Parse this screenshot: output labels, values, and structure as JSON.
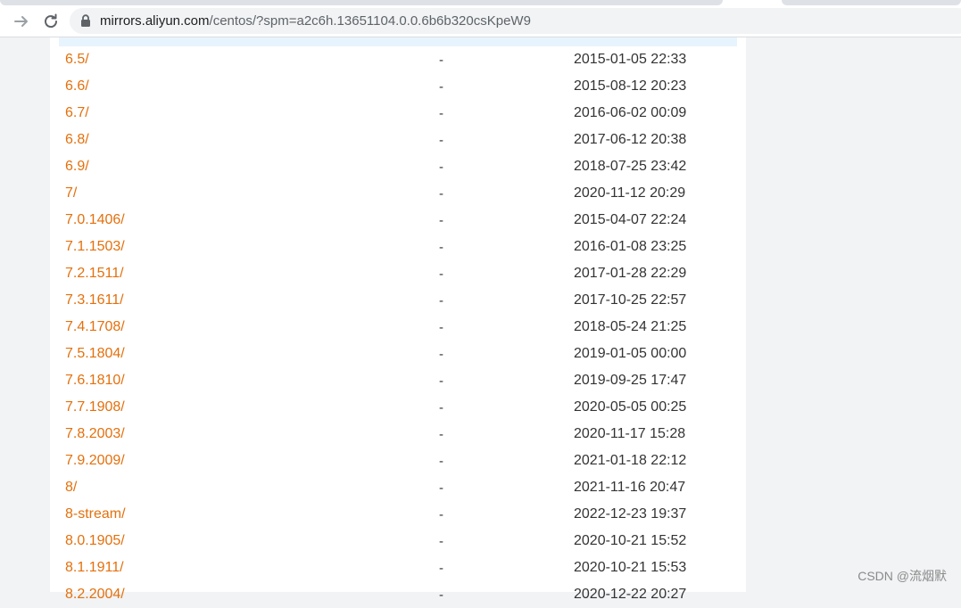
{
  "browser": {
    "url_host": "mirrors.aliyun.com",
    "url_path": "/centos/?spm=a2c6h.13651104.0.0.6b6b320csKpeW9",
    "back_icon": "arrow-right-icon",
    "reload_icon": "reload-icon",
    "lock_icon": "lock-icon"
  },
  "listing": {
    "rows": [
      {
        "name": "6.5/",
        "size": "-",
        "date": "2015-01-05 22:33"
      },
      {
        "name": "6.6/",
        "size": "-",
        "date": "2015-08-12 20:23"
      },
      {
        "name": "6.7/",
        "size": "-",
        "date": "2016-06-02 00:09"
      },
      {
        "name": "6.8/",
        "size": "-",
        "date": "2017-06-12 20:38"
      },
      {
        "name": "6.9/",
        "size": "-",
        "date": "2018-07-25 23:42"
      },
      {
        "name": "7/",
        "size": "-",
        "date": "2020-11-12 20:29"
      },
      {
        "name": "7.0.1406/",
        "size": "-",
        "date": "2015-04-07 22:24"
      },
      {
        "name": "7.1.1503/",
        "size": "-",
        "date": "2016-01-08 23:25"
      },
      {
        "name": "7.2.1511/",
        "size": "-",
        "date": "2017-01-28 22:29"
      },
      {
        "name": "7.3.1611/",
        "size": "-",
        "date": "2017-10-25 22:57"
      },
      {
        "name": "7.4.1708/",
        "size": "-",
        "date": "2018-05-24 21:25"
      },
      {
        "name": "7.5.1804/",
        "size": "-",
        "date": "2019-01-05 00:00"
      },
      {
        "name": "7.6.1810/",
        "size": "-",
        "date": "2019-09-25 17:47"
      },
      {
        "name": "7.7.1908/",
        "size": "-",
        "date": "2020-05-05 00:25"
      },
      {
        "name": "7.8.2003/",
        "size": "-",
        "date": "2020-11-17 15:28"
      },
      {
        "name": "7.9.2009/",
        "size": "-",
        "date": "2021-01-18 22:12"
      },
      {
        "name": "8/",
        "size": "-",
        "date": "2021-11-16 20:47"
      },
      {
        "name": "8-stream/",
        "size": "-",
        "date": "2022-12-23 19:37"
      },
      {
        "name": "8.0.1905/",
        "size": "-",
        "date": "2020-10-21 15:52"
      },
      {
        "name": "8.1.1911/",
        "size": "-",
        "date": "2020-10-21 15:53"
      },
      {
        "name": "8.2.2004/",
        "size": "-",
        "date": "2020-12-22 20:27"
      }
    ]
  },
  "watermark": "CSDN @流烟默",
  "colors": {
    "link": "#e4700c",
    "text": "#333333",
    "header_strip": "#e8f4fd"
  }
}
